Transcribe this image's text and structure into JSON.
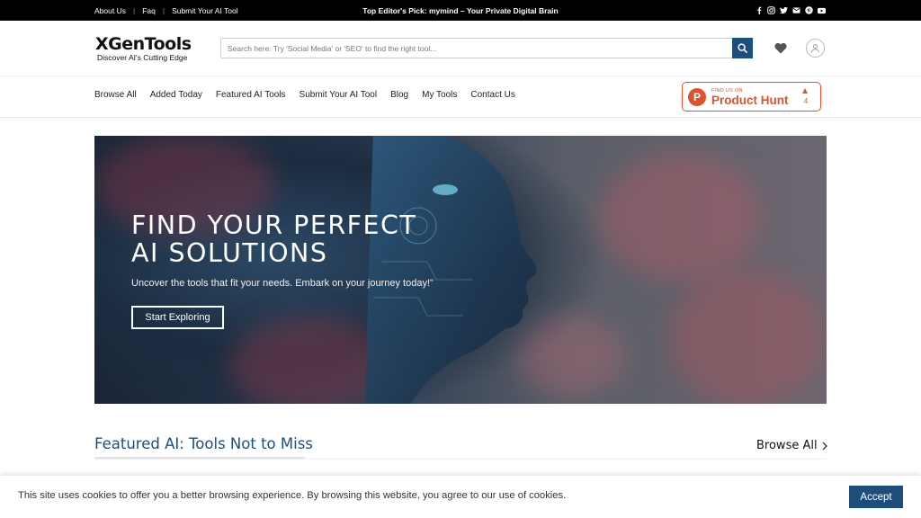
{
  "topbar": {
    "links": [
      "About Us",
      "Faq",
      "Submit Your AI Tool"
    ],
    "separator": "|",
    "editors_pick": "Top Editor's Pick: mymind – Your Private Digital Brain",
    "social_icons": [
      "facebook-icon",
      "instagram-icon",
      "twitter-icon",
      "mail-icon",
      "pinterest-icon",
      "youtube-icon"
    ]
  },
  "header": {
    "logo_name": "XGenTools",
    "logo_tagline": "Discover AI's Cutting Edge",
    "search_placeholder": "Search here: Try 'Social Media' or 'SEO' to find the right tool...",
    "search_icon": "search-icon",
    "wishlist_icon": "heart-icon",
    "account_icon": "user-icon"
  },
  "nav": {
    "items": [
      "Browse All",
      "Added Today",
      "Featured AI Tools",
      "Submit Your AI Tool",
      "Blog",
      "My Tools",
      "Contact Us"
    ]
  },
  "product_hunt": {
    "badge_letter": "P",
    "caption": "FIND US ON",
    "name": "Product Hunt",
    "votes": "4",
    "color": "#da552f"
  },
  "hero": {
    "headline_line1": "FIND YOUR PERFECT",
    "headline_line2": "AI SOLUTIONS",
    "subtitle": "Uncover the tools that fit your needs. Embark on your journey today!\"",
    "cta_label": "Start Exploring"
  },
  "featured": {
    "title": "Featured AI: Tools Not to Miss",
    "browse_all_label": "Browse All"
  },
  "cookie": {
    "message": "This site uses cookies to offer you a better browsing experience. By browsing this website, you agree to our use of cookies.",
    "accept_label": "Accept"
  },
  "colors": {
    "brand_blue": "#1f4d7a",
    "topbar_bg": "#000000",
    "product_hunt": "#da552f"
  }
}
